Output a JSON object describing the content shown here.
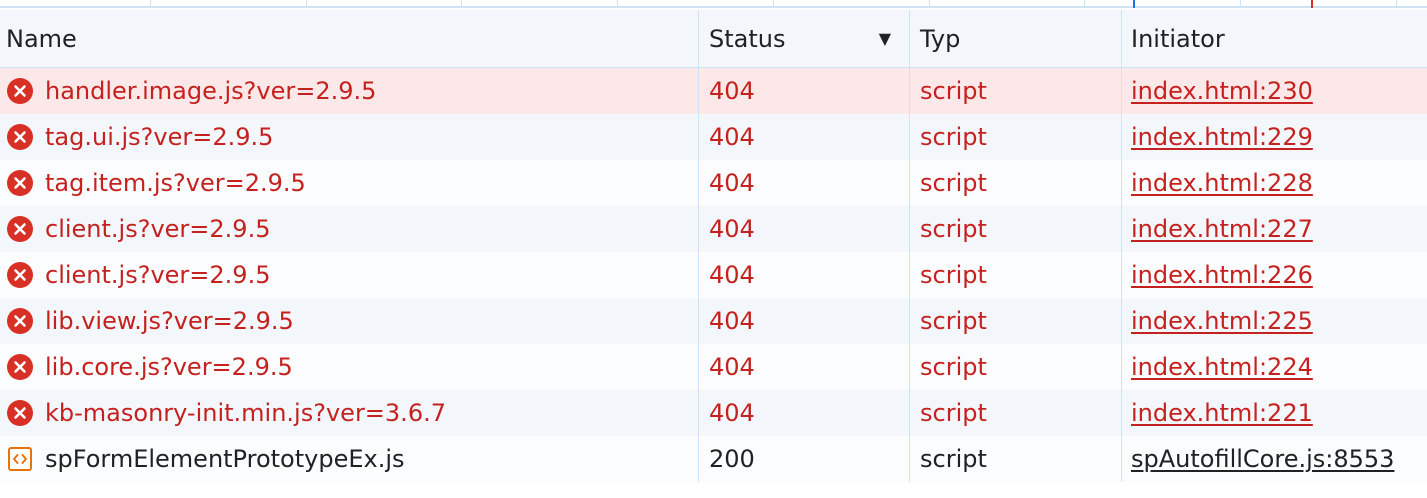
{
  "columns": {
    "name": "Name",
    "status": "Status",
    "type": "Typ",
    "initiator": "Initiator",
    "sort_indicator": "▼"
  },
  "colors": {
    "error_text": "#c5221f",
    "error_icon": "#d93025",
    "script_icon": "#e8710a",
    "selected_row": "#fce8e8",
    "alt_row": "#f3f6fa",
    "border": "#cfe3f6"
  },
  "rows": [
    {
      "icon": "error-icon",
      "name": "handler.image.js?ver=2.9.5",
      "status": "404",
      "type": "script",
      "initiator": "index.html:230"
    },
    {
      "icon": "error-icon",
      "name": "tag.ui.js?ver=2.9.5",
      "status": "404",
      "type": "script",
      "initiator": "index.html:229"
    },
    {
      "icon": "error-icon",
      "name": "tag.item.js?ver=2.9.5",
      "status": "404",
      "type": "script",
      "initiator": "index.html:228"
    },
    {
      "icon": "error-icon",
      "name": "client.js?ver=2.9.5",
      "status": "404",
      "type": "script",
      "initiator": "index.html:227"
    },
    {
      "icon": "error-icon",
      "name": "client.js?ver=2.9.5",
      "status": "404",
      "type": "script",
      "initiator": "index.html:226"
    },
    {
      "icon": "error-icon",
      "name": "lib.view.js?ver=2.9.5",
      "status": "404",
      "type": "script",
      "initiator": "index.html:225"
    },
    {
      "icon": "error-icon",
      "name": "lib.core.js?ver=2.9.5",
      "status": "404",
      "type": "script",
      "initiator": "index.html:224"
    },
    {
      "icon": "error-icon",
      "name": "kb-masonry-init.min.js?ver=3.6.7",
      "status": "404",
      "type": "script",
      "initiator": "index.html:221"
    },
    {
      "icon": "script-icon",
      "name": "spFormElementPrototypeEx.js",
      "status": "200",
      "type": "script",
      "initiator": "spAutofillCore.js:8553"
    }
  ]
}
